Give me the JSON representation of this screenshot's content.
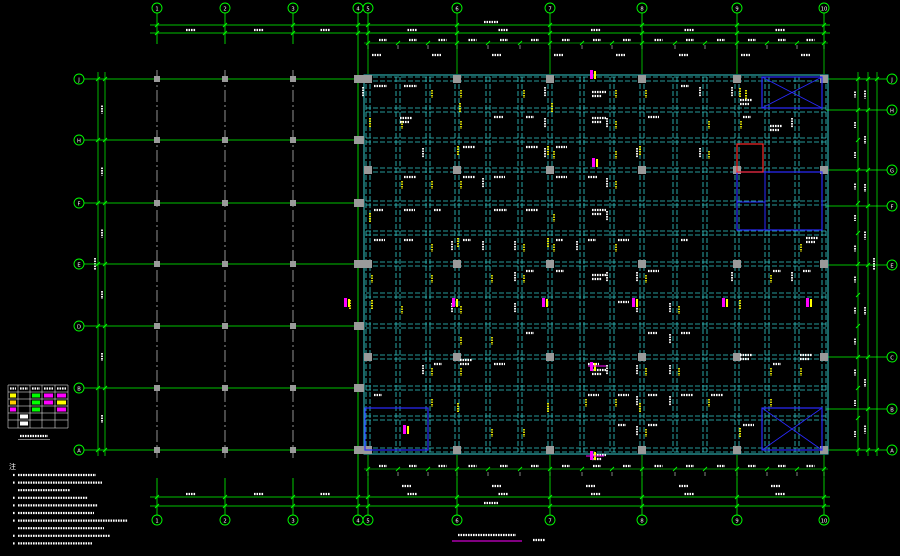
{
  "drawing": {
    "background": "#000000",
    "axis_color": "#00ff00",
    "beam_color": "#33cccc",
    "column_color": "#9a9a9a",
    "opening_color": "#2a2aff",
    "highlight_color": "#ff2a2a",
    "label_color": "#ffffff",
    "marker_color": "#ffff00",
    "tag_color": "#ff00ff",
    "centerline_color": "#cfcfcf"
  },
  "axes": {
    "top": [
      "1",
      "2",
      "3",
      "4",
      "5",
      "6",
      "7",
      "8",
      "9",
      "10"
    ],
    "bottom": [
      "1",
      "2",
      "3",
      "4",
      "5",
      "6",
      "7",
      "8",
      "9",
      "10"
    ],
    "left": [
      "J",
      "H",
      "F",
      "E",
      "D",
      "B",
      "A"
    ],
    "right": [
      "J",
      "H",
      "G",
      "F",
      "E",
      "C",
      "B",
      "A"
    ]
  },
  "notes": {
    "heading": "注"
  }
}
